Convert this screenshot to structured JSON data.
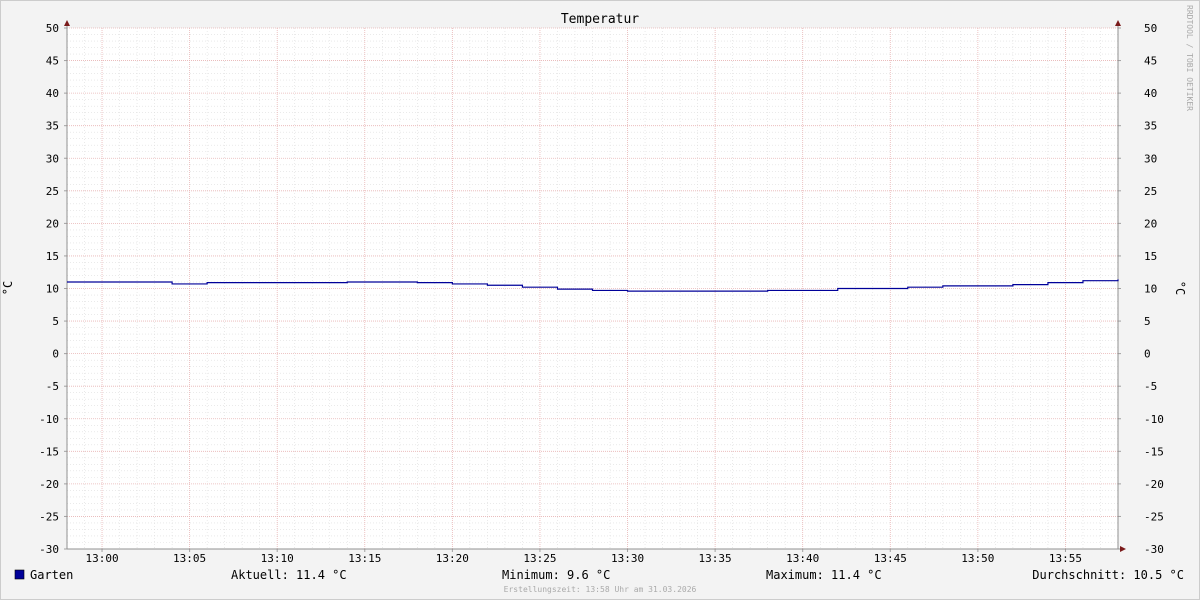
{
  "chart_data": {
    "type": "line",
    "title": "Temperatur",
    "ylabel": "°C",
    "ylim": [
      -30,
      50
    ],
    "y_major_ticks": [
      50,
      45,
      40,
      35,
      30,
      25,
      20,
      15,
      10,
      5,
      0,
      -5,
      -10,
      -15,
      -20,
      -25,
      -30
    ],
    "y_tick_labels": [
      "50",
      "45",
      "40",
      "35",
      "30",
      "25",
      "20",
      "15",
      "10",
      "5",
      "0",
      "-5",
      "-10",
      "-15",
      "-20",
      "-25",
      "-30"
    ],
    "xlim": [
      "12:58",
      "13:58"
    ],
    "x_tick_labels": [
      "13:00",
      "13:05",
      "13:10",
      "13:15",
      "13:20",
      "13:25",
      "13:30",
      "13:35",
      "13:40",
      "13:45",
      "13:50",
      "13:55"
    ],
    "grid": true,
    "series": [
      {
        "name": "Garten",
        "color": "#000099",
        "x": [
          "12:58",
          "13:04",
          "13:06",
          "13:14",
          "13:18",
          "13:20",
          "13:22",
          "13:24",
          "13:26",
          "13:28",
          "13:30",
          "13:38",
          "13:42",
          "13:46",
          "13:48",
          "13:52",
          "13:54",
          "13:56",
          "13:58"
        ],
        "values": [
          11.0,
          10.7,
          10.9,
          11.0,
          10.9,
          10.7,
          10.5,
          10.2,
          9.9,
          9.7,
          9.6,
          9.7,
          10.0,
          10.2,
          10.4,
          10.6,
          10.9,
          11.2,
          11.4
        ]
      }
    ]
  },
  "legend": {
    "series_label": "Garten",
    "swatch_color": "#000099",
    "current": "Aktuell: 11.4 °C",
    "minimum": "Minimum: 9.6 °C",
    "maximum": "Maximum: 11.4 °C",
    "average": "Durchschnitt: 10.5 °C"
  },
  "footer": {
    "created": "Erstellungszeit: 13:58 Uhr am 31.03.2026"
  },
  "watermark": "RRDTOOL / TOBI OETIKER"
}
